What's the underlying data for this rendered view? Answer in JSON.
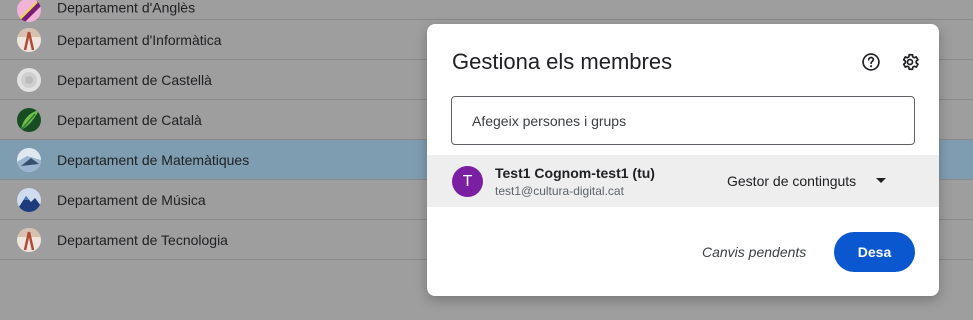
{
  "departments": [
    {
      "label": "Departament d'Anglès",
      "icon": "pen-nib-icon",
      "colors": [
        "#f2b3d9",
        "#7a1a78",
        "#e9d84a"
      ]
    },
    {
      "label": "Departament d'Informàtica",
      "icon": "compass-icon",
      "colors": [
        "#d7c2b2",
        "#b14a33",
        "#efe6df"
      ]
    },
    {
      "label": "Departament de Castellà",
      "icon": "book-icon",
      "colors": [
        "#cfcfcf",
        "#bdbdbd",
        "#e2e2e2"
      ]
    },
    {
      "label": "Departament de Català",
      "icon": "leaf-icon",
      "colors": [
        "#2f7a3a",
        "#6fbf4a",
        "#174d22"
      ]
    },
    {
      "label": "Departament de Matemàtiques",
      "icon": "shapes-icon",
      "colors": [
        "#9bb4cf",
        "#36506e",
        "#dfe8f1"
      ],
      "selected": true
    },
    {
      "label": "Departament de Música",
      "icon": "mountain-icon",
      "colors": [
        "#1c3c7c",
        "#cfdcef",
        "#4d79b8"
      ]
    },
    {
      "label": "Departament de Tecnologia",
      "icon": "compass-icon",
      "colors": [
        "#d7c2b2",
        "#b14a33",
        "#efe6df"
      ]
    }
  ],
  "dialog": {
    "title": "Gestiona els membres",
    "help_icon": "help-icon",
    "settings_icon": "gear-icon",
    "add_placeholder": "Afegeix persones i grups",
    "member": {
      "avatar_letter": "T",
      "avatar_color": "#7b1fa2",
      "name": "Test1 Cognom-test1 (tu)",
      "email": "test1@cultura-digital.cat",
      "role": "Gestor de continguts"
    },
    "pending_text": "Canvis pendents",
    "save_label": "Desa",
    "save_color": "#0b57d0"
  }
}
